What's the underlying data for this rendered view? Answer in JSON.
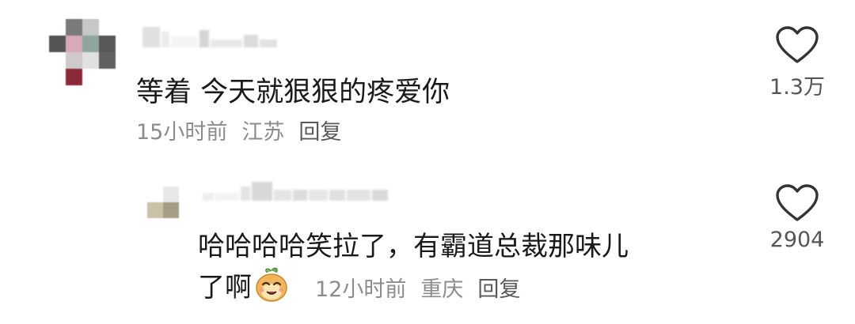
{
  "comment": {
    "text": "等着 今天就狠狠的疼爱你",
    "time": "15小时前",
    "region": "江苏",
    "reply_label": "回复",
    "likes": "1.3万",
    "heart_icon": "heart-outline-icon"
  },
  "reply": {
    "text_line1": "哈哈哈哈笑拉了，有霸道总裁那味儿",
    "text_line2": "了啊",
    "emoji_icon": "sly-smile-emoji-icon",
    "time": "12小时前",
    "region": "重庆",
    "reply_label": "回复",
    "likes": "2904",
    "heart_icon": "heart-outline-icon"
  },
  "colors": {
    "text": "#1a1a1a",
    "meta": "#8c8c8c",
    "heart_stroke": "#333333"
  }
}
